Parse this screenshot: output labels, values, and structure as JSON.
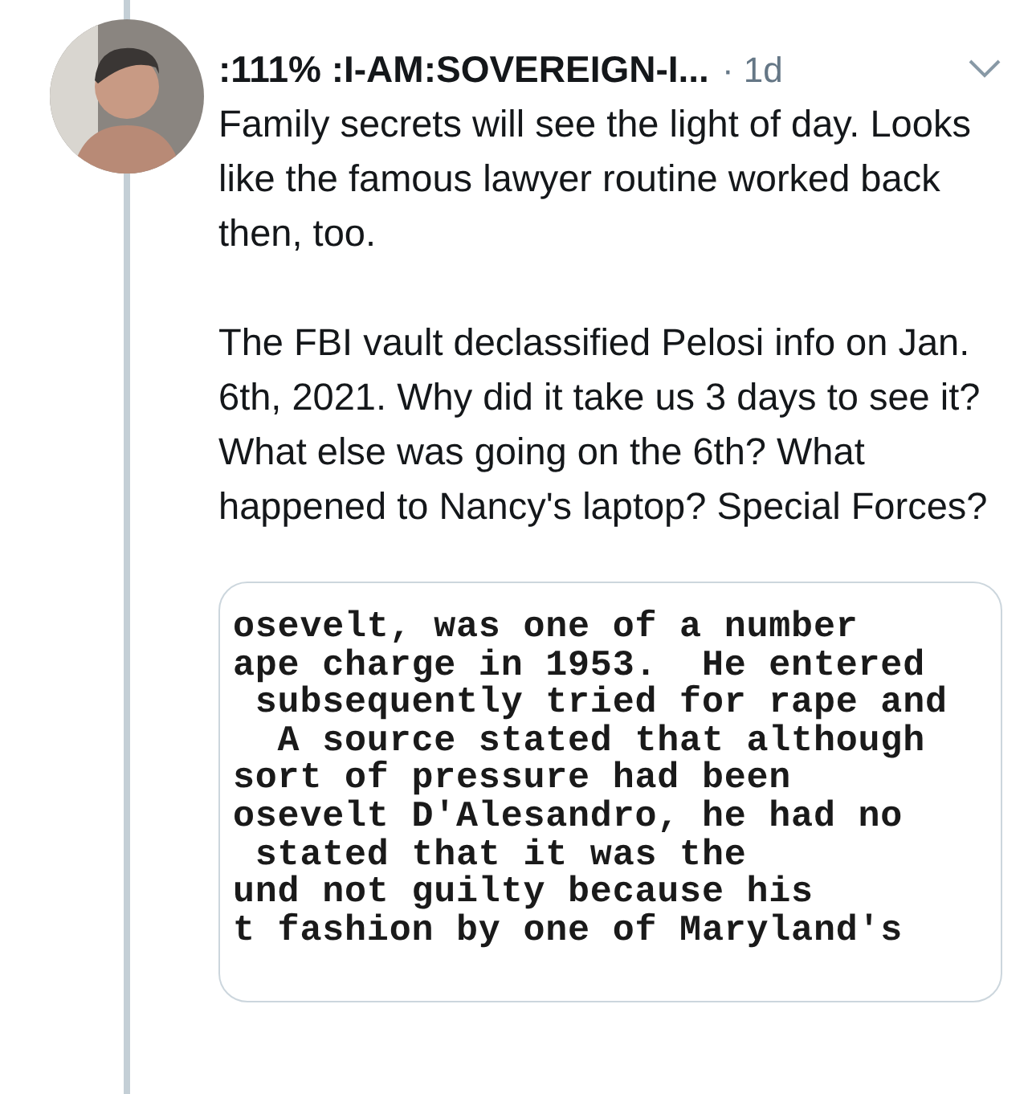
{
  "tweet": {
    "author": ":111% :I-AM:SOVEREIGN-I...",
    "time": "· 1d",
    "paragraphs": [
      "Family secrets will see the light of day. Looks like the famous lawyer routine worked back then, too.",
      "The FBI vault declassified Pelosi info on Jan. 6th, 2021. Why did it take us 3 days to see it? What else was going on the 6th? What happened to Nancy's laptop? Special Forces?"
    ],
    "document_lines": [
      "osevelt, was one of a number",
      "ape charge in 1953.  He entered",
      " subsequently tried for rape and",
      "  A source stated that although",
      "sort of pressure had been",
      "osevelt D'Alesandro, he had no",
      " stated that it was the",
      "und not guilty because his",
      "t fashion by one of Maryland's"
    ]
  }
}
